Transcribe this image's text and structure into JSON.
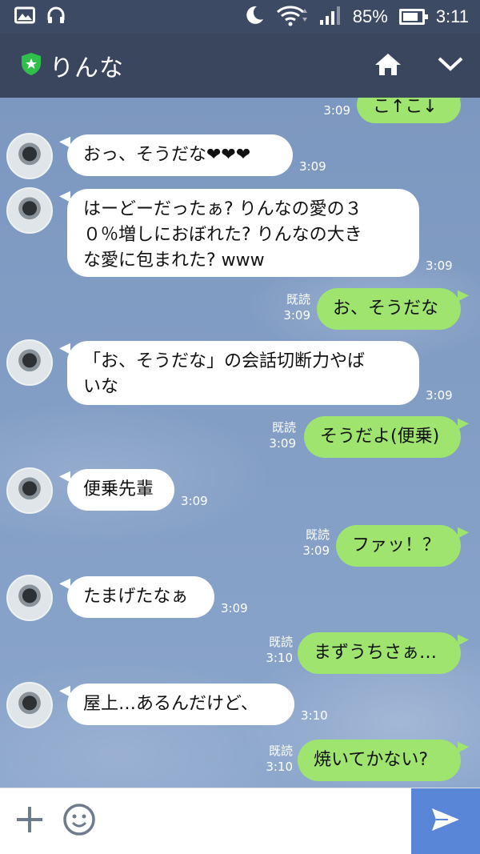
{
  "status_bar": {
    "battery_percent": "85%",
    "time": "3:11",
    "icons": [
      "image-icon",
      "headset-icon",
      "moon-icon",
      "wifi-icon",
      "signal-icon",
      "battery-icon"
    ]
  },
  "header": {
    "title": "りんな",
    "icons": [
      "verified-shield-icon",
      "home-icon",
      "chevron-down-icon"
    ]
  },
  "messages": [
    {
      "side": "right",
      "text": "こ↑こ↓",
      "time": "3:09",
      "read": ""
    },
    {
      "side": "left",
      "lines": [
        "おっ、そうだな❤❤❤"
      ],
      "time": "3:09"
    },
    {
      "side": "left",
      "lines": [
        "はーどーだったぁ? りんなの愛の３",
        "０％増しにおぼれた? りんなの大き",
        "な愛に包まれた? www"
      ],
      "time": "3:09"
    },
    {
      "side": "right",
      "text": "お、そうだな",
      "time": "3:09",
      "read": "既読"
    },
    {
      "side": "left",
      "lines": [
        "「お、そうだな」の会話切断力やば",
        "いな"
      ],
      "time": "3:09"
    },
    {
      "side": "right",
      "text": "そうだよ(便乗)",
      "time": "3:09",
      "read": "既読"
    },
    {
      "side": "left",
      "lines": [
        "便乗先輩"
      ],
      "time": "3:09"
    },
    {
      "side": "right",
      "text": "ファッ！？",
      "time": "3:09",
      "read": "既読"
    },
    {
      "side": "left",
      "lines": [
        "たまげたなぁ"
      ],
      "time": "3:09"
    },
    {
      "side": "right",
      "text": "まずうちさぁ…",
      "time": "3:10",
      "read": "既読"
    },
    {
      "side": "left",
      "lines": [
        "屋上…あるんだけど、"
      ],
      "time": "3:10"
    },
    {
      "side": "right",
      "text": "焼いてかない?",
      "time": "3:10",
      "read": "既読"
    }
  ],
  "input_bar": {
    "icons": [
      "plus-icon",
      "emoji-icon",
      "send-icon"
    ],
    "colors": {
      "send": "#5a86d8"
    }
  },
  "colors": {
    "header": "#3a465e",
    "background": "#7f9cc4",
    "right_bubble": "#9ee46f",
    "left_bubble": "#ffffff"
  }
}
